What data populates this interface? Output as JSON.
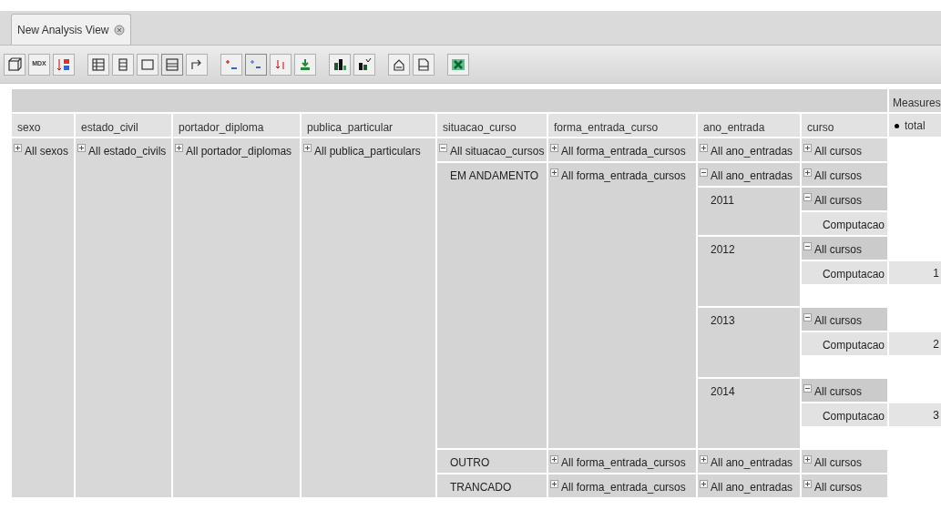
{
  "tab": {
    "title": "New Analysis View",
    "selected": true
  },
  "toolbar": {
    "mdx_label": "MDX"
  },
  "measures_label": "Measures",
  "columns": [
    "sexo",
    "estado_civil",
    "portador_diploma",
    "publica_particular",
    "situacao_curso",
    "forma_entrada_curso",
    "ano_entrada",
    "curso"
  ],
  "measure_header": {
    "label": "total",
    "selected": true
  },
  "rows": [
    {
      "kind": "data",
      "cells": [
        {
          "label": "All sexos",
          "expanded": false
        },
        {
          "label": "All estado_civils",
          "expanded": false
        },
        {
          "label": "All portador_diplomas",
          "expanded": false
        },
        {
          "label": "All publica_particulars",
          "expanded": false
        },
        {
          "label": "All situacao_cursos",
          "expanded": true
        },
        {
          "label": "All forma_entrada_cursos",
          "expanded": false
        },
        {
          "label": "All ano_entradas",
          "expanded": false
        },
        {
          "label": "All cursos",
          "expanded": false
        }
      ]
    },
    {
      "kind": "data",
      "cells": [
        null,
        null,
        null,
        null,
        {
          "label": "EM ANDAMENTO"
        },
        {
          "label": "All forma_entrada_cursos",
          "expanded": false
        },
        {
          "label": "All ano_entradas",
          "expanded": true
        },
        {
          "label": "All cursos",
          "expanded": false
        }
      ]
    },
    {
      "kind": "data",
      "cells": [
        null,
        null,
        null,
        null,
        null,
        null,
        {
          "label": "2011"
        },
        {
          "label": "All cursos",
          "expanded": true
        }
      ]
    },
    {
      "kind": "data",
      "cells": [
        null,
        null,
        null,
        null,
        null,
        null,
        null,
        {
          "label": "Computacao"
        }
      ]
    },
    {
      "kind": "data",
      "cells": [
        null,
        null,
        null,
        null,
        null,
        null,
        {
          "label": "2012"
        },
        {
          "label": "All cursos",
          "expanded": true
        }
      ]
    },
    {
      "kind": "data",
      "cells": [
        null,
        null,
        null,
        null,
        null,
        null,
        null,
        {
          "label": "Computacao"
        },
        {
          "value": "1"
        }
      ]
    },
    {
      "kind": "spacer",
      "cells": [
        null,
        null,
        null,
        null,
        null,
        null,
        null
      ]
    },
    {
      "kind": "data",
      "cells": [
        null,
        null,
        null,
        null,
        null,
        null,
        {
          "label": "2013"
        },
        {
          "label": "All cursos",
          "expanded": true
        }
      ]
    },
    {
      "kind": "data",
      "cells": [
        null,
        null,
        null,
        null,
        null,
        null,
        null,
        {
          "label": "Computacao"
        },
        {
          "value": "2"
        }
      ]
    },
    {
      "kind": "spacer",
      "cells": [
        null,
        null,
        null,
        null,
        null,
        null,
        null
      ]
    },
    {
      "kind": "data",
      "cells": [
        null,
        null,
        null,
        null,
        null,
        null,
        {
          "label": "2014"
        },
        {
          "label": "All cursos",
          "expanded": true
        }
      ]
    },
    {
      "kind": "data",
      "cells": [
        null,
        null,
        null,
        null,
        null,
        null,
        null,
        {
          "label": "Computacao"
        },
        {
          "value": "3"
        }
      ]
    },
    {
      "kind": "spacer",
      "cells": [
        null,
        null,
        null,
        null,
        null,
        null,
        null
      ]
    },
    {
      "kind": "data",
      "cells": [
        null,
        null,
        null,
        null,
        {
          "label": "OUTRO"
        },
        {
          "label": "All forma_entrada_cursos",
          "expanded": false
        },
        {
          "label": "All ano_entradas",
          "expanded": false
        },
        {
          "label": "All cursos",
          "expanded": false
        }
      ]
    },
    {
      "kind": "data",
      "cells": [
        null,
        null,
        null,
        null,
        {
          "label": "TRANCADO"
        },
        {
          "label": "All forma_entrada_cursos",
          "expanded": false
        },
        {
          "label": "All ano_entradas",
          "expanded": false
        },
        {
          "label": "All cursos",
          "expanded": false
        }
      ]
    }
  ]
}
